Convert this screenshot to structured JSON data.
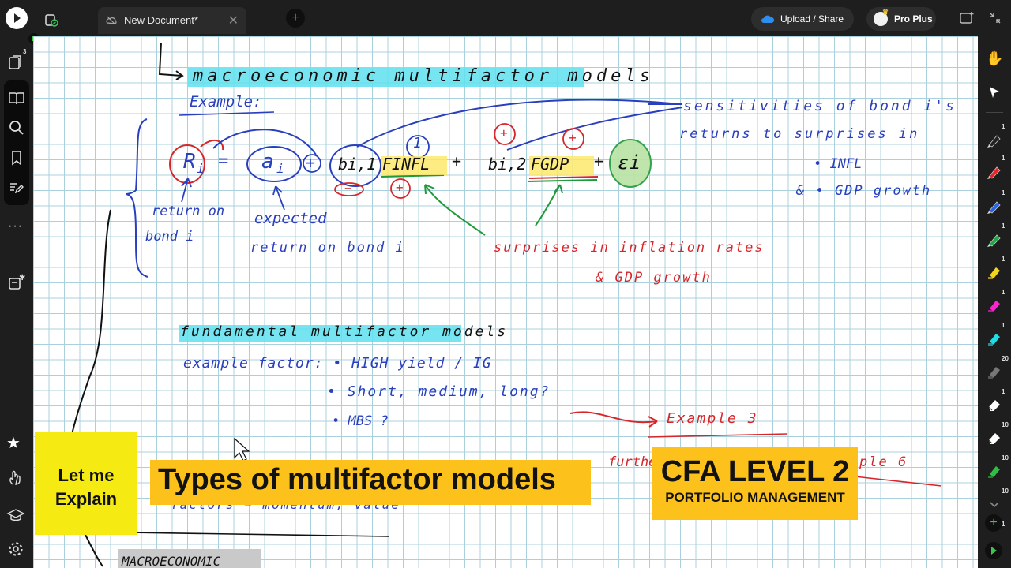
{
  "app": {
    "tab_title": "New Document*",
    "upload_label": "Upload / Share",
    "plan_label": "Pro Plus",
    "pages_count": "3"
  },
  "notes": {
    "l1": "macroeconomic multifactor models",
    "l2": "Example:",
    "eq_R": "R",
    "eq_i1": "i",
    "eq_eq": "=",
    "eq_a": "a",
    "eq_i2": "i",
    "eq_plus1": "+",
    "eq_b1": "bi,1",
    "eq_F1": "FINFL",
    "eq_plus2": "+",
    "eq_b2": "bi,2",
    "eq_F2": "FGDP",
    "eq_plus3": "+",
    "eq_eps": "εi",
    "one": "1",
    "pm_plus1": "+",
    "pm_plus2": "+",
    "pm_plus3": "+",
    "pm_minus": "−",
    "ret1": "return on",
    "ret2": "bond i",
    "exp1": "expected",
    "exp2": "return on bond i",
    "surp1": "surprises in inflation rates",
    "surp2": "& GDP growth",
    "sens1": "sensitivities of bond i's",
    "sens2": "returns to surprises in",
    "sens3": "• INFL",
    "sens4": "& • GDP growth",
    "fund": "fundamental multifactor models",
    "fx1": "example factor: • HIGH yield / IG",
    "fx2": "• Short, medium, long?",
    "fx3": "• MBS ?",
    "ex3": "Example 3",
    "further": "further",
    "ex6": "ple 6",
    "factor": "factors = momentum, value",
    "macro2": "MACROECONOMIC"
  },
  "overlay": {
    "let1": "Let me",
    "let2": "Explain",
    "title": "Types of multifactor models",
    "cfa1": "CFA LEVEL 2",
    "cfa2": "PORTFOLIO MANAGEMENT"
  },
  "tool_counts": [
    "1",
    "1",
    "1",
    "1",
    "1",
    "1",
    "1",
    "20",
    "1",
    "10",
    "10",
    "10",
    "1"
  ],
  "colors": {
    "blue_ink": "#2a3fbe",
    "red_ink": "#d7262a",
    "green_ink": "#1f9a3a",
    "cyan_highlight": "#5ee0ee",
    "yellow_highlight": "#fbe96b",
    "overlay_yellow": "#fcc21b",
    "let_yellow": "#f5ea12"
  }
}
